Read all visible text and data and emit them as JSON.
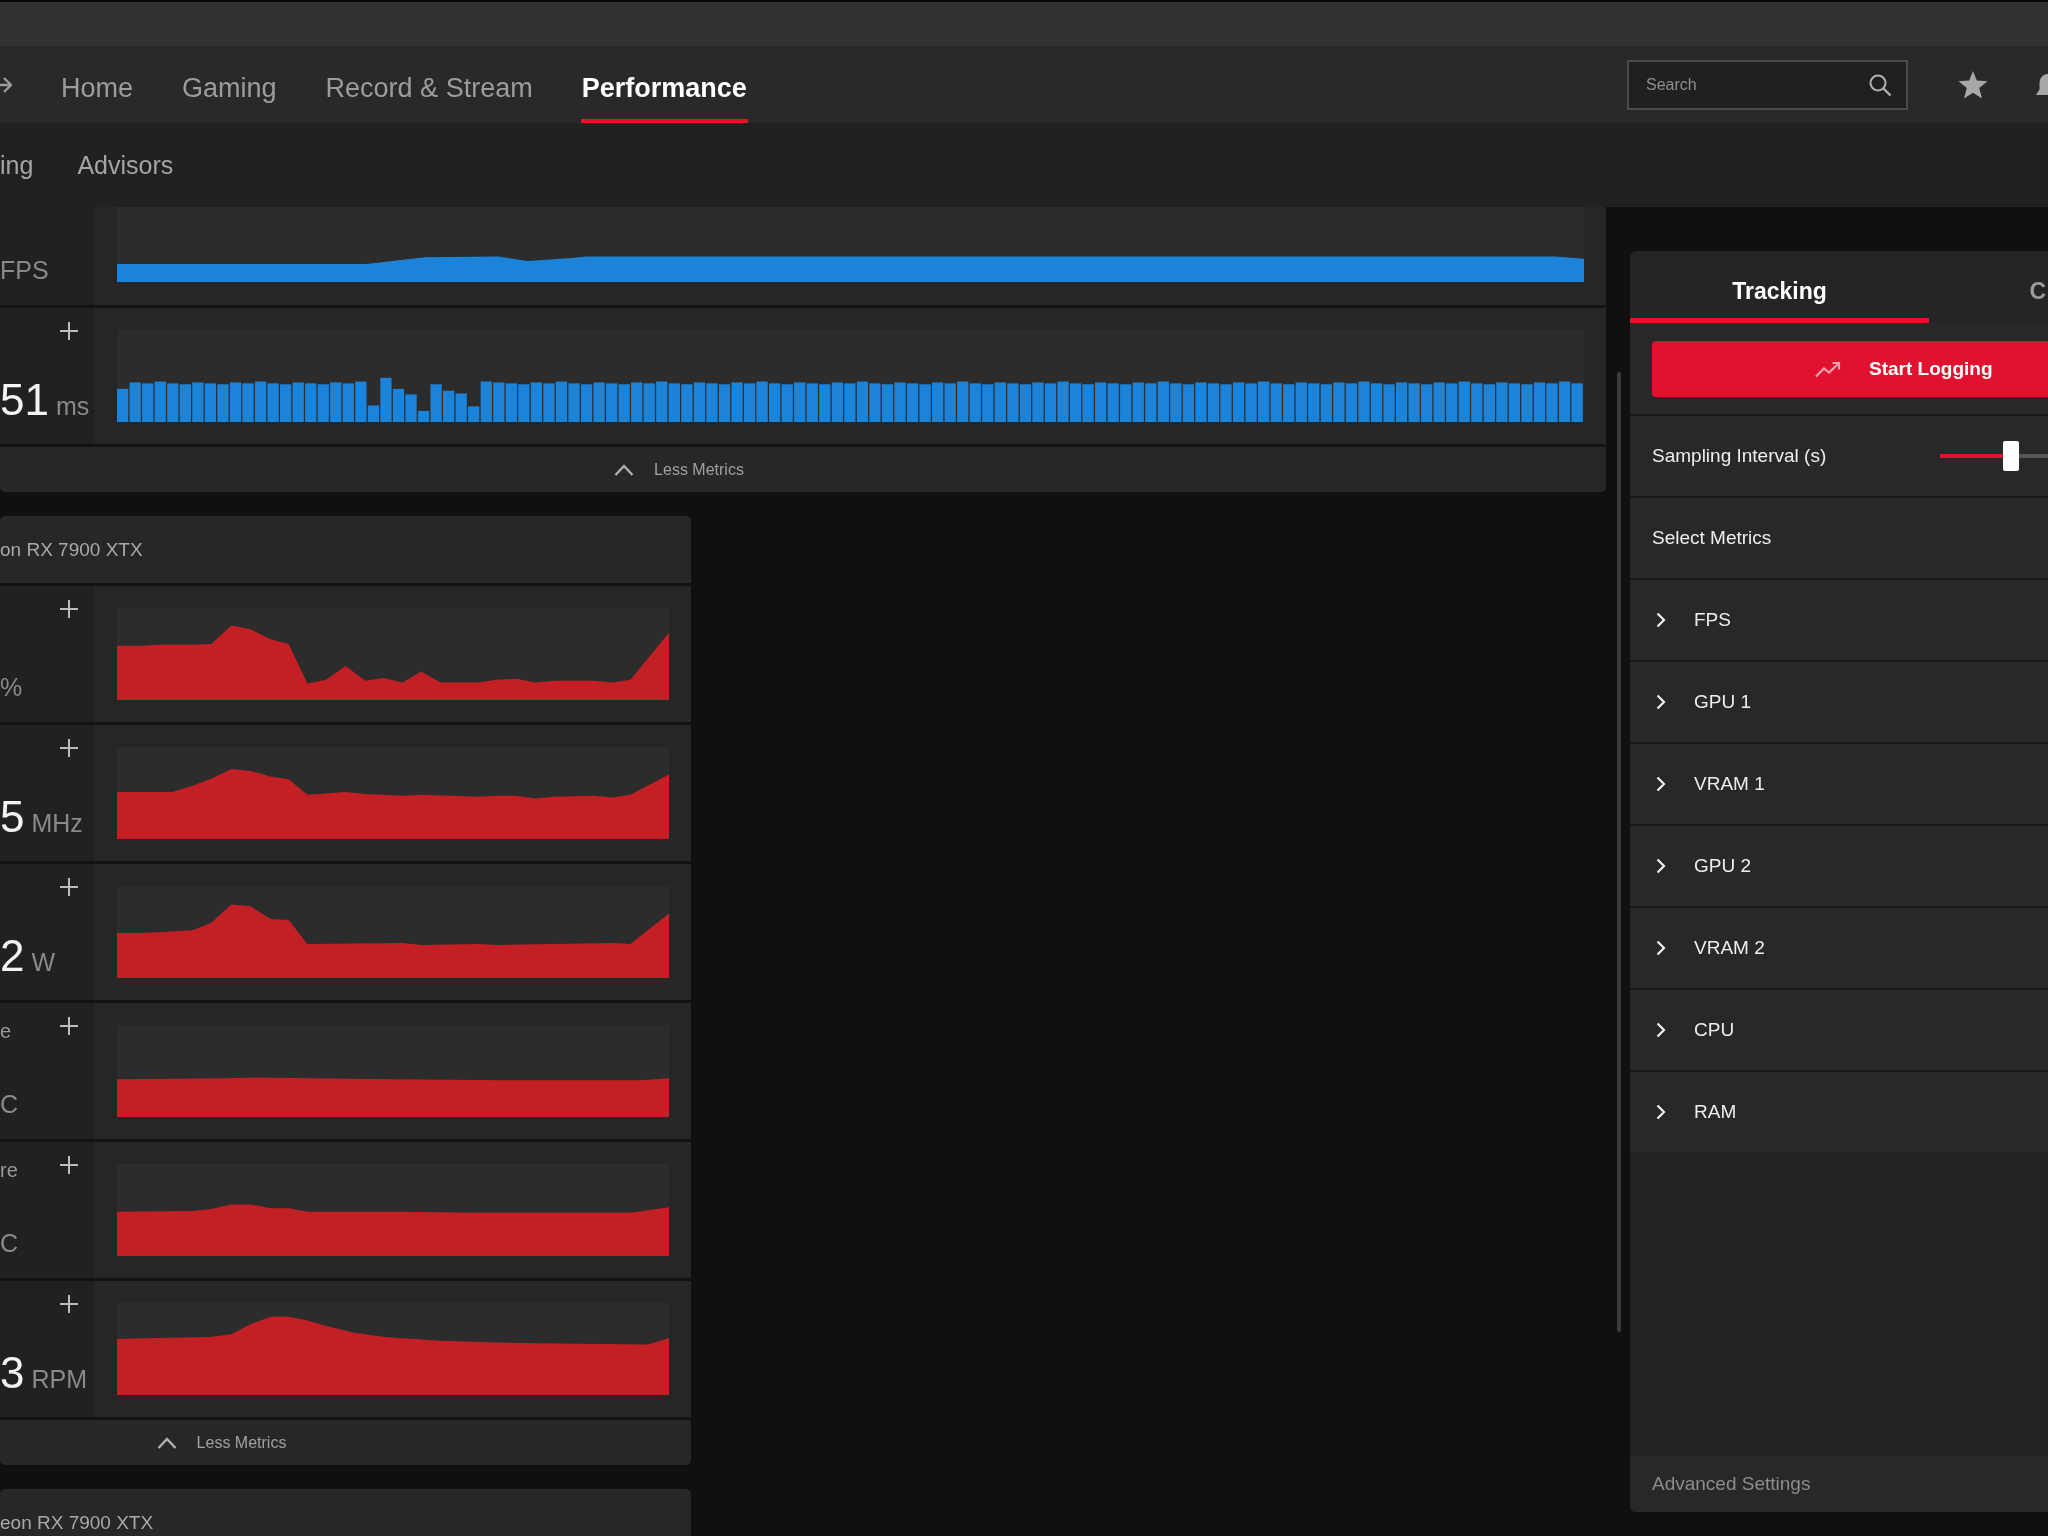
{
  "nav": {
    "tabs": [
      {
        "label": "Home",
        "selected": false
      },
      {
        "label": "Gaming",
        "selected": false
      },
      {
        "label": "Record & Stream",
        "selected": false
      },
      {
        "label": "Performance",
        "selected": true
      }
    ],
    "search": {
      "placeholder": "Search"
    }
  },
  "subnav": {
    "tabs": [
      {
        "label": "ing",
        "selected": false
      },
      {
        "label": "Advisors",
        "selected": false
      }
    ]
  },
  "cards": [
    {
      "color": "#1c84d8",
      "rows": [
        {
          "kind": "area",
          "unit": "FPS"
        },
        {
          "kind": "bars",
          "value": "51",
          "unit": "ms"
        }
      ],
      "footer": "Less Metrics"
    },
    {
      "title": "on RX 7900 XTX",
      "color": "#c32025",
      "rows": [
        {
          "kind": "area",
          "unit": "%"
        },
        {
          "kind": "area",
          "value": "5",
          "unit": "MHz"
        },
        {
          "kind": "area",
          "value": "2",
          "unit": "W"
        },
        {
          "kind": "area",
          "label": "e",
          "unit": "C"
        },
        {
          "kind": "area",
          "label": "re",
          "unit": "C"
        },
        {
          "kind": "area",
          "value": "3",
          "unit": "RPM"
        }
      ],
      "footer": "Less Metrics"
    },
    {
      "title": "eon RX 7900 XTX"
    }
  ],
  "tracking": {
    "tabs": [
      {
        "label": "Tracking",
        "selected": true
      },
      {
        "label": "C",
        "selected": false
      }
    ],
    "start_button": "Start Logging",
    "sampling_interval": {
      "label": "Sampling Interval (s)",
      "level": 0.66
    },
    "select_metrics": "Select Metrics",
    "metric_groups": [
      {
        "label": "FPS",
        "expanded": false
      },
      {
        "label": "GPU 1",
        "expanded": false
      },
      {
        "label": "VRAM 1",
        "expanded": false
      },
      {
        "label": "GPU 2",
        "expanded": false
      },
      {
        "label": "VRAM 2",
        "expanded": false
      },
      {
        "label": "CPU",
        "expanded": false
      },
      {
        "label": "RAM",
        "expanded": false
      }
    ],
    "advanced_settings": "Advanced Settings"
  }
}
